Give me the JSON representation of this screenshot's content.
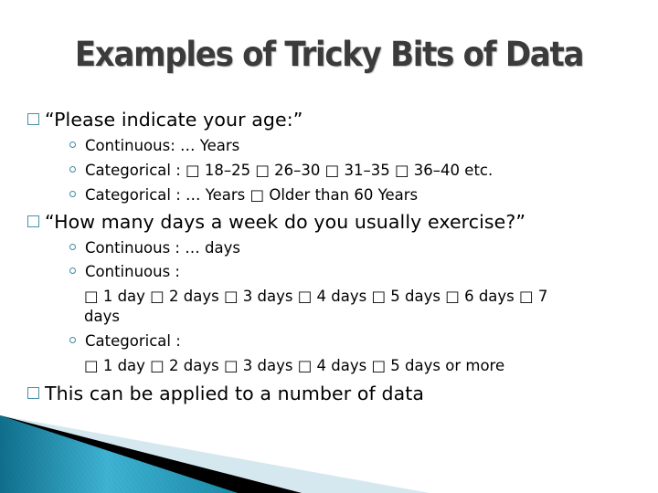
{
  "slide": {
    "title": "Examples of Tricky Bits of Data",
    "colors": {
      "title": "#3b3b3b",
      "accent": "#2a8fb0",
      "bullet": "#4a90a8"
    },
    "bullets": [
      {
        "text": "“Please indicate your age:”",
        "subs": [
          "Continuous: … Years",
          "Categorical :  □ 18–25  □ 26–30  □ 31–35  □ 36–40  etc.",
          "Categorical : … Years □ Older than 60 Years"
        ]
      },
      {
        "text": "“How many days a week do you usually exercise?”",
        "subs": [
          "Continuous : … days",
          "Continuous :",
          "Categorical :"
        ],
        "continuous_options_line1": "□ 1 day  □ 2 days  □ 3 days  □ 4 days □ 5 days □ 6 days □ 7",
        "continuous_options_line2": "days",
        "categorical_options": "□ 1 day  □ 2 days  □ 3 days  □ 4 days □ 5 days or more"
      },
      {
        "text": "This can be applied to a number of data"
      }
    ]
  }
}
